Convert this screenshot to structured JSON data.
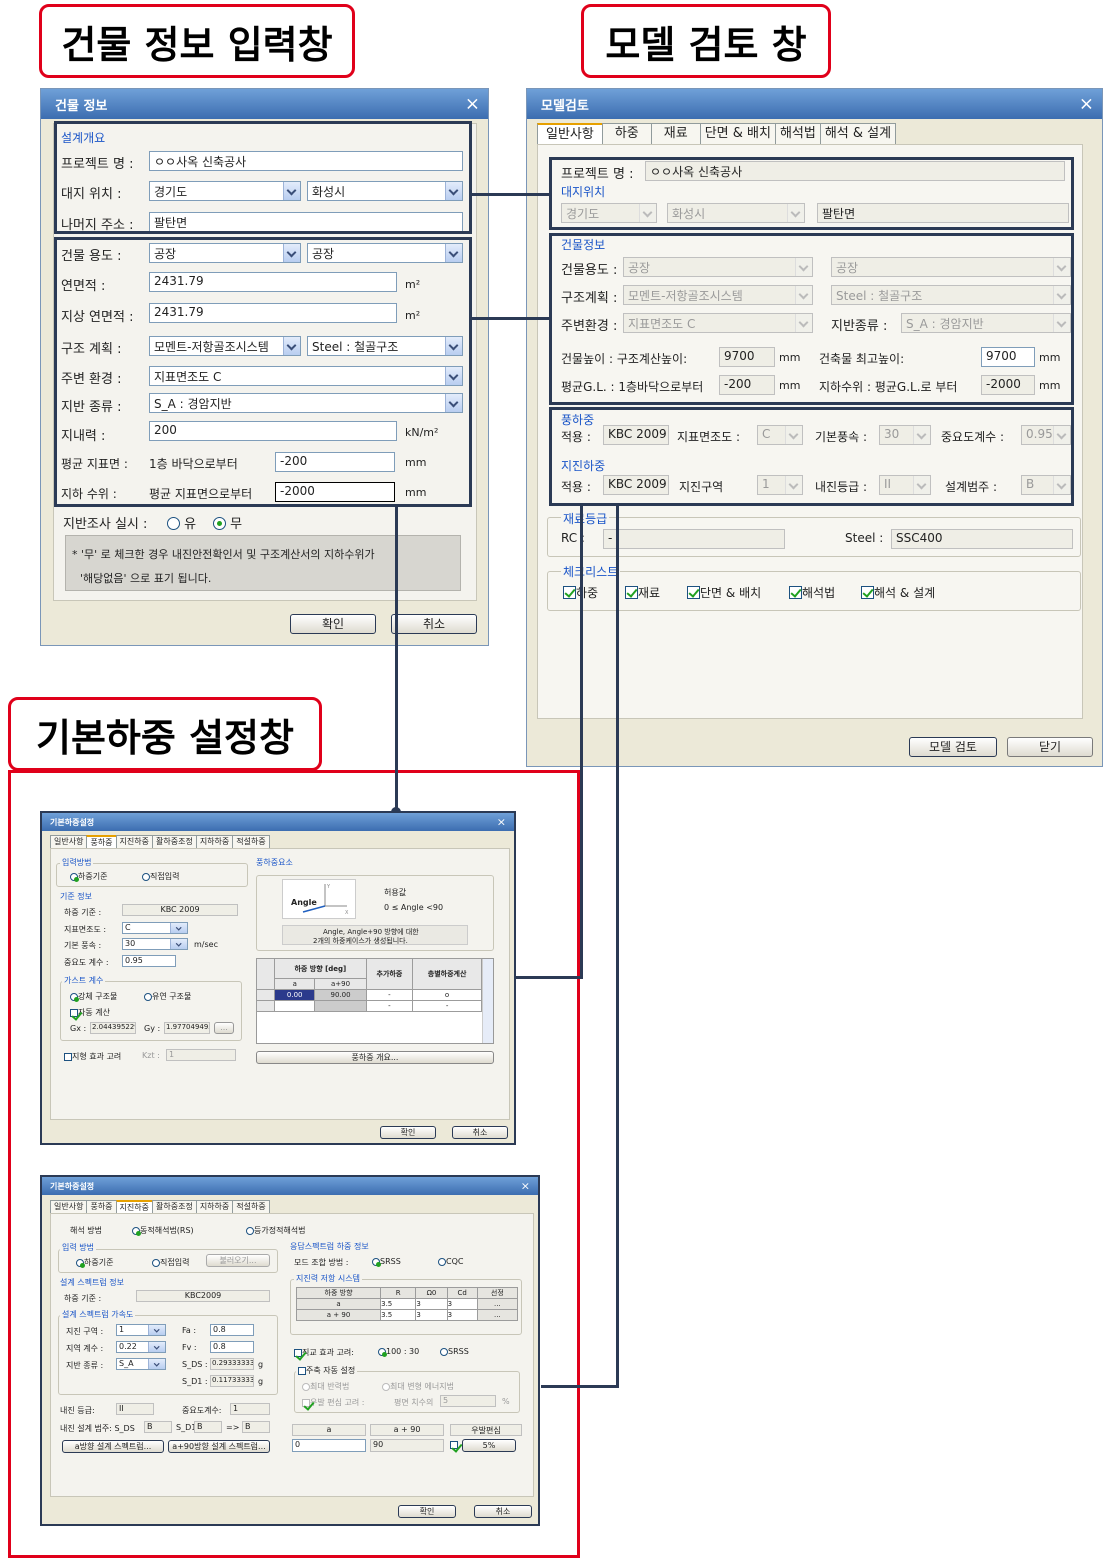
{
  "labels": {
    "building_info": "건물 정보 입력창",
    "model_review": "모델 검토 창",
    "basic_load": "기본하중 설정창"
  },
  "bldg": {
    "title": "건물 정보",
    "close": "×",
    "overview": "설계개요",
    "project_label": "프로젝트 명 :",
    "project_value": "ㅇㅇ사옥 신축공사",
    "site_label": "대지 위치 :",
    "province": "경기도",
    "city": "화성시",
    "addr_label": "나머지 주소 :",
    "addr_value": "팔탄면",
    "use_label": "건물 용도 :",
    "use1": "공장",
    "use2": "공장",
    "area_label": "연면적 :",
    "area_value": "2431.79",
    "area_unit": "m²",
    "garea_label": "지상 연면적 :",
    "garea_value": "2431.79",
    "garea_unit": "m²",
    "struct_label": "구조 계획 :",
    "struct1": "모멘트-저항골조시스템",
    "struct2": "Steel : 철골구조",
    "env_label": "주변 환경 :",
    "env_value": "지표면조도 C",
    "soil_label": "지반 종류 :",
    "soil_value": "S_A : 경암지반",
    "bearing_label": "지내력 :",
    "bearing_value": "200",
    "bearing_unit": "kN/m²",
    "gl_label": "평균 지표면 :",
    "gl_sub": "1층 바닥으로부터",
    "gl_value": "-200",
    "gl_unit": "mm",
    "wl_label": "지하 수위 :",
    "wl_sub": "평균 지표면으로부터",
    "wl_value": "-2000",
    "wl_unit": "mm",
    "survey_label": "지반조사 실시 :",
    "survey_yes": "유",
    "survey_no": "무",
    "note1": "* '무' 로 체크한 경우 내진안전확인서 및 구조계산서의 지하수위가",
    "note2": "'해당없음' 으로 표기 됩니다.",
    "ok": "확인",
    "cancel": "취소"
  },
  "model": {
    "title": "모델검토",
    "close": "×",
    "tabs": [
      "일반사항",
      "하중",
      "재료",
      "단면 & 배치",
      "해석법",
      "해석 & 설계"
    ],
    "project_label": "프로젝트 명 :",
    "project_value": "ㅇㅇ사옥 신축공사",
    "site_label": "대지위치",
    "province": "경기도",
    "city": "화성시",
    "addr": "팔탄면",
    "bldg_label": "건물정보",
    "use_label": "건물용도 :",
    "use1": "공장",
    "use2": "공장",
    "struct_label": "구조계획 :",
    "struct1": "모멘트-저항골조시스템",
    "struct2": "Steel : 철골구조",
    "env_label": "주변환경 :",
    "env_value": "지표면조도 C",
    "soil_label": "지반종류 :",
    "soil_value": "S_A : 경암지반",
    "h_label": "건물높이 : 구조계산높이:",
    "h_value": "9700",
    "h_unit": "mm",
    "hmax_label": "건축물 최고높이:",
    "hmax_value": "9700",
    "hmax_unit": "mm",
    "gl_label": "평균G.L. : 1층바닥으로부터",
    "gl_value": "-200",
    "gl_unit": "mm",
    "wl_label": "지하수위 : 평균G.L.로 부터",
    "wl_value": "-2000",
    "wl_unit": "mm",
    "wind_label": "풍하중",
    "wind_apply": "적용 :",
    "wind_code": "KBC 2009",
    "wind_rough_label": "지표면조도 :",
    "wind_rough": "C",
    "wind_speed_label": "기본풍속 :",
    "wind_speed": "30",
    "wind_imp_label": "중요도계수 :",
    "wind_imp": "0.95",
    "eq_label": "지진하중",
    "eq_apply": "적용 :",
    "eq_code": "KBC 2009",
    "eq_zone_label": "지진구역",
    "eq_zone": "1",
    "eq_grade_label": "내진등급 :",
    "eq_grade": "II",
    "eq_cat_label": "설계범주 :",
    "eq_cat": "B",
    "mat_label": "재료등급",
    "rc_label": "RC :",
    "rc_value": "-",
    "steel_label": "Steel :",
    "steel_value": "SSC400",
    "check_label": "체크리스트",
    "checks": [
      "하중",
      "재료",
      "단면 & 배치",
      "해석법",
      "해석 & 설계"
    ],
    "review_btn": "모델 검토",
    "close_btn": "닫기"
  },
  "wind": {
    "title": "기본하중설정",
    "close": "×",
    "tabs": [
      "일반사항",
      "풍하중",
      "지진하중",
      "활하중조정",
      "지하하중",
      "적설하중"
    ],
    "input_method": "입력방법",
    "opt_std": "하중기준",
    "opt_direct": "직접입력",
    "basis": "기준 정보",
    "code_label": "하중 기준 :",
    "code_value": "KBC 2009",
    "rough_label": "지표면조도 :",
    "rough_value": "C",
    "speed_label": "기본 풍속 :",
    "speed_value": "30",
    "speed_unit": "m/sec",
    "imp_label": "중요도 계수 :",
    "imp_value": "0.95",
    "gust": "가스트 계수",
    "rigid": "강체 구조물",
    "flex": "유연 구조물",
    "auto": "자동 계산",
    "gx_label": "Gx :",
    "gx_value": "2.044395229",
    "gy_label": "Gy :",
    "gy_value": "1.977049495",
    "more": "...",
    "topo_label": "지형 효과 고려",
    "kzt_label": "Kzt :",
    "kzt_value": "1",
    "elements": "풍하중요소",
    "angle": "Angle",
    "allow": "허용값",
    "range": "0 ≤ Angle <90",
    "desc1": "Angle, Angle+90 방향에 대한",
    "desc2": "2개의 하중케이스가 생성됩니다.",
    "col_dir": "하중 방향 [deg]",
    "col_add": "추가하중",
    "col_torsion": "층별하중계산",
    "col_a": "a",
    "col_a90": "a+90",
    "row_a": "0.00",
    "row_a90": "90.00",
    "row_add": "-",
    "row_tor": "o",
    "row2_add": "-",
    "row2_tor": "-",
    "summary": "풍하중 개요...",
    "ok": "확인",
    "cancel": "취소"
  },
  "seismic": {
    "title": "기본하중설정",
    "close": "×",
    "tabs": [
      "일반사항",
      "풍하중",
      "지진하중",
      "활하중조정",
      "지하하중",
      "적설하중"
    ],
    "method_label": "해석 방법",
    "rs": "동적해석법(RS)",
    "es": "등가정적해석법",
    "input": "입력 방법",
    "opt_std": "하중기준",
    "opt_direct": "직접입력",
    "load_btn": "불러오기...",
    "spec": "설계 스펙트럼 정보",
    "code_label": "하중 기준 :",
    "code_value": "KBC2009",
    "accel": "설계 스펙트럼 가속도",
    "zone_label": "지진 구역 :",
    "zone_value": "1",
    "fa_label": "Fa :",
    "fa_value": "0.8",
    "coef_label": "지역 계수 :",
    "coef_value": "0.22",
    "fv_label": "Fv :",
    "fv_value": "0.8",
    "soil_label": "지반 종류 :",
    "soil_value": "S_A",
    "sds_label": "S_DS :",
    "sds_value": "0.293333333",
    "sds_unit": "g",
    "sd1_label": "S_D1 :",
    "sd1_value": "0.117333333",
    "sd1_unit": "g",
    "grade_label": "내진 등급:",
    "grade_value": "II",
    "imp_label": "중요도계수:",
    "imp_value": "1",
    "cat_label": "내진 설계 범주: S_DS",
    "cat_sds": "B",
    "cat_sd1_label": "S_D1",
    "cat_sd1": "B",
    "cat_arrow": "=>",
    "cat_result": "B",
    "btn_a": "a방향 설계 스펙트럼...",
    "btn_a90": "a+90방향 설계 스펙트럼...",
    "resp": "응답스펙트럼 하중 정보",
    "mode_label": "모드 조합 방법 :",
    "srss": "SRSS",
    "cqc": "CQC",
    "system": "지진력 저항 시스템",
    "col_dir": "하중 방향",
    "col_r": "R",
    "col_o": "Ω0",
    "col_cd": "Cd",
    "col_sel": "선정",
    "rows": [
      {
        "dir": "a",
        "r": "3.5",
        "o": "3",
        "cd": "3"
      },
      {
        "dir": "a + 90",
        "r": "3.5",
        "o": "3",
        "cd": "3"
      }
    ],
    "ortho_label": "직교 효과 고려:",
    "ortho_100": "100 : 30",
    "ortho_srss": "SRSS",
    "axis_label": "주축 자동 설정",
    "max_resp": "최대 반력법",
    "max_energy": "최대 변형 에너지법",
    "ecc_label": "우발 편심 고려 :",
    "plan_label": "평면 치수의",
    "plan_value": "5",
    "plan_unit": "%",
    "bot_a": "a",
    "bot_a90": "a + 90",
    "bot_ecc": "우발편심",
    "bot_a_val": "0",
    "bot_a90_val": "90",
    "bot_pct": "5%",
    "ok": "확인",
    "cancel": "취소"
  }
}
